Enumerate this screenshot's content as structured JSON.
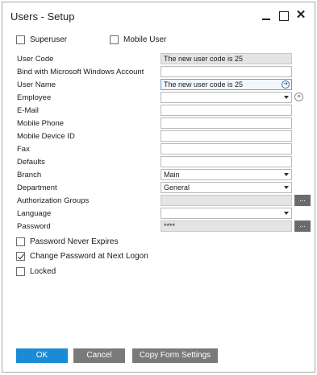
{
  "window": {
    "title": "Users - Setup"
  },
  "checkboxes_top": {
    "superuser": {
      "label": "Superuser",
      "checked": false
    },
    "mobile_user": {
      "label": "Mobile User",
      "checked": false
    }
  },
  "fields": {
    "user_code": {
      "label": "User Code",
      "value": "The new user code is 25"
    },
    "bind_windows": {
      "label": "Bind with Microsoft Windows Account",
      "value": ""
    },
    "user_name": {
      "label": "User Name",
      "value": "The new user code is 25"
    },
    "employee": {
      "label": "Employee",
      "value": ""
    },
    "email": {
      "label": "E-Mail",
      "value": ""
    },
    "mobile_phone": {
      "label": "Mobile Phone",
      "value": ""
    },
    "mobile_device_id": {
      "label": "Mobile Device ID",
      "value": ""
    },
    "fax": {
      "label": "Fax",
      "value": ""
    },
    "defaults": {
      "label": "Defaults",
      "value": ""
    },
    "branch": {
      "label": "Branch",
      "value": "Main"
    },
    "department": {
      "label": "Department",
      "value": "General"
    },
    "authorization_groups": {
      "label": "Authorization Groups",
      "value": ""
    },
    "language": {
      "label": "Language",
      "value": ""
    },
    "password": {
      "label": "Password",
      "value": "****"
    }
  },
  "checkboxes_bottom": {
    "password_never_expires": {
      "label": "Password Never Expires",
      "checked": false
    },
    "change_password": {
      "label": "Change Password at Next Logon",
      "checked": true
    },
    "locked": {
      "label": "Locked",
      "checked": false
    }
  },
  "buttons": {
    "ellipsis": "...",
    "ok": "OK",
    "cancel": "Cancel",
    "copy_form_settings": "Copy Form Settings"
  },
  "icons": {
    "minimize": "minimize-icon",
    "maximize": "maximize-icon",
    "close": "close-icon",
    "link_arrow": "link-arrow-icon",
    "list_details": "list-details-icon"
  },
  "colors": {
    "primary_button": "#1a8bd6",
    "secondary_button": "#7a7a7a",
    "readonly_field": "#e4e4e4"
  }
}
